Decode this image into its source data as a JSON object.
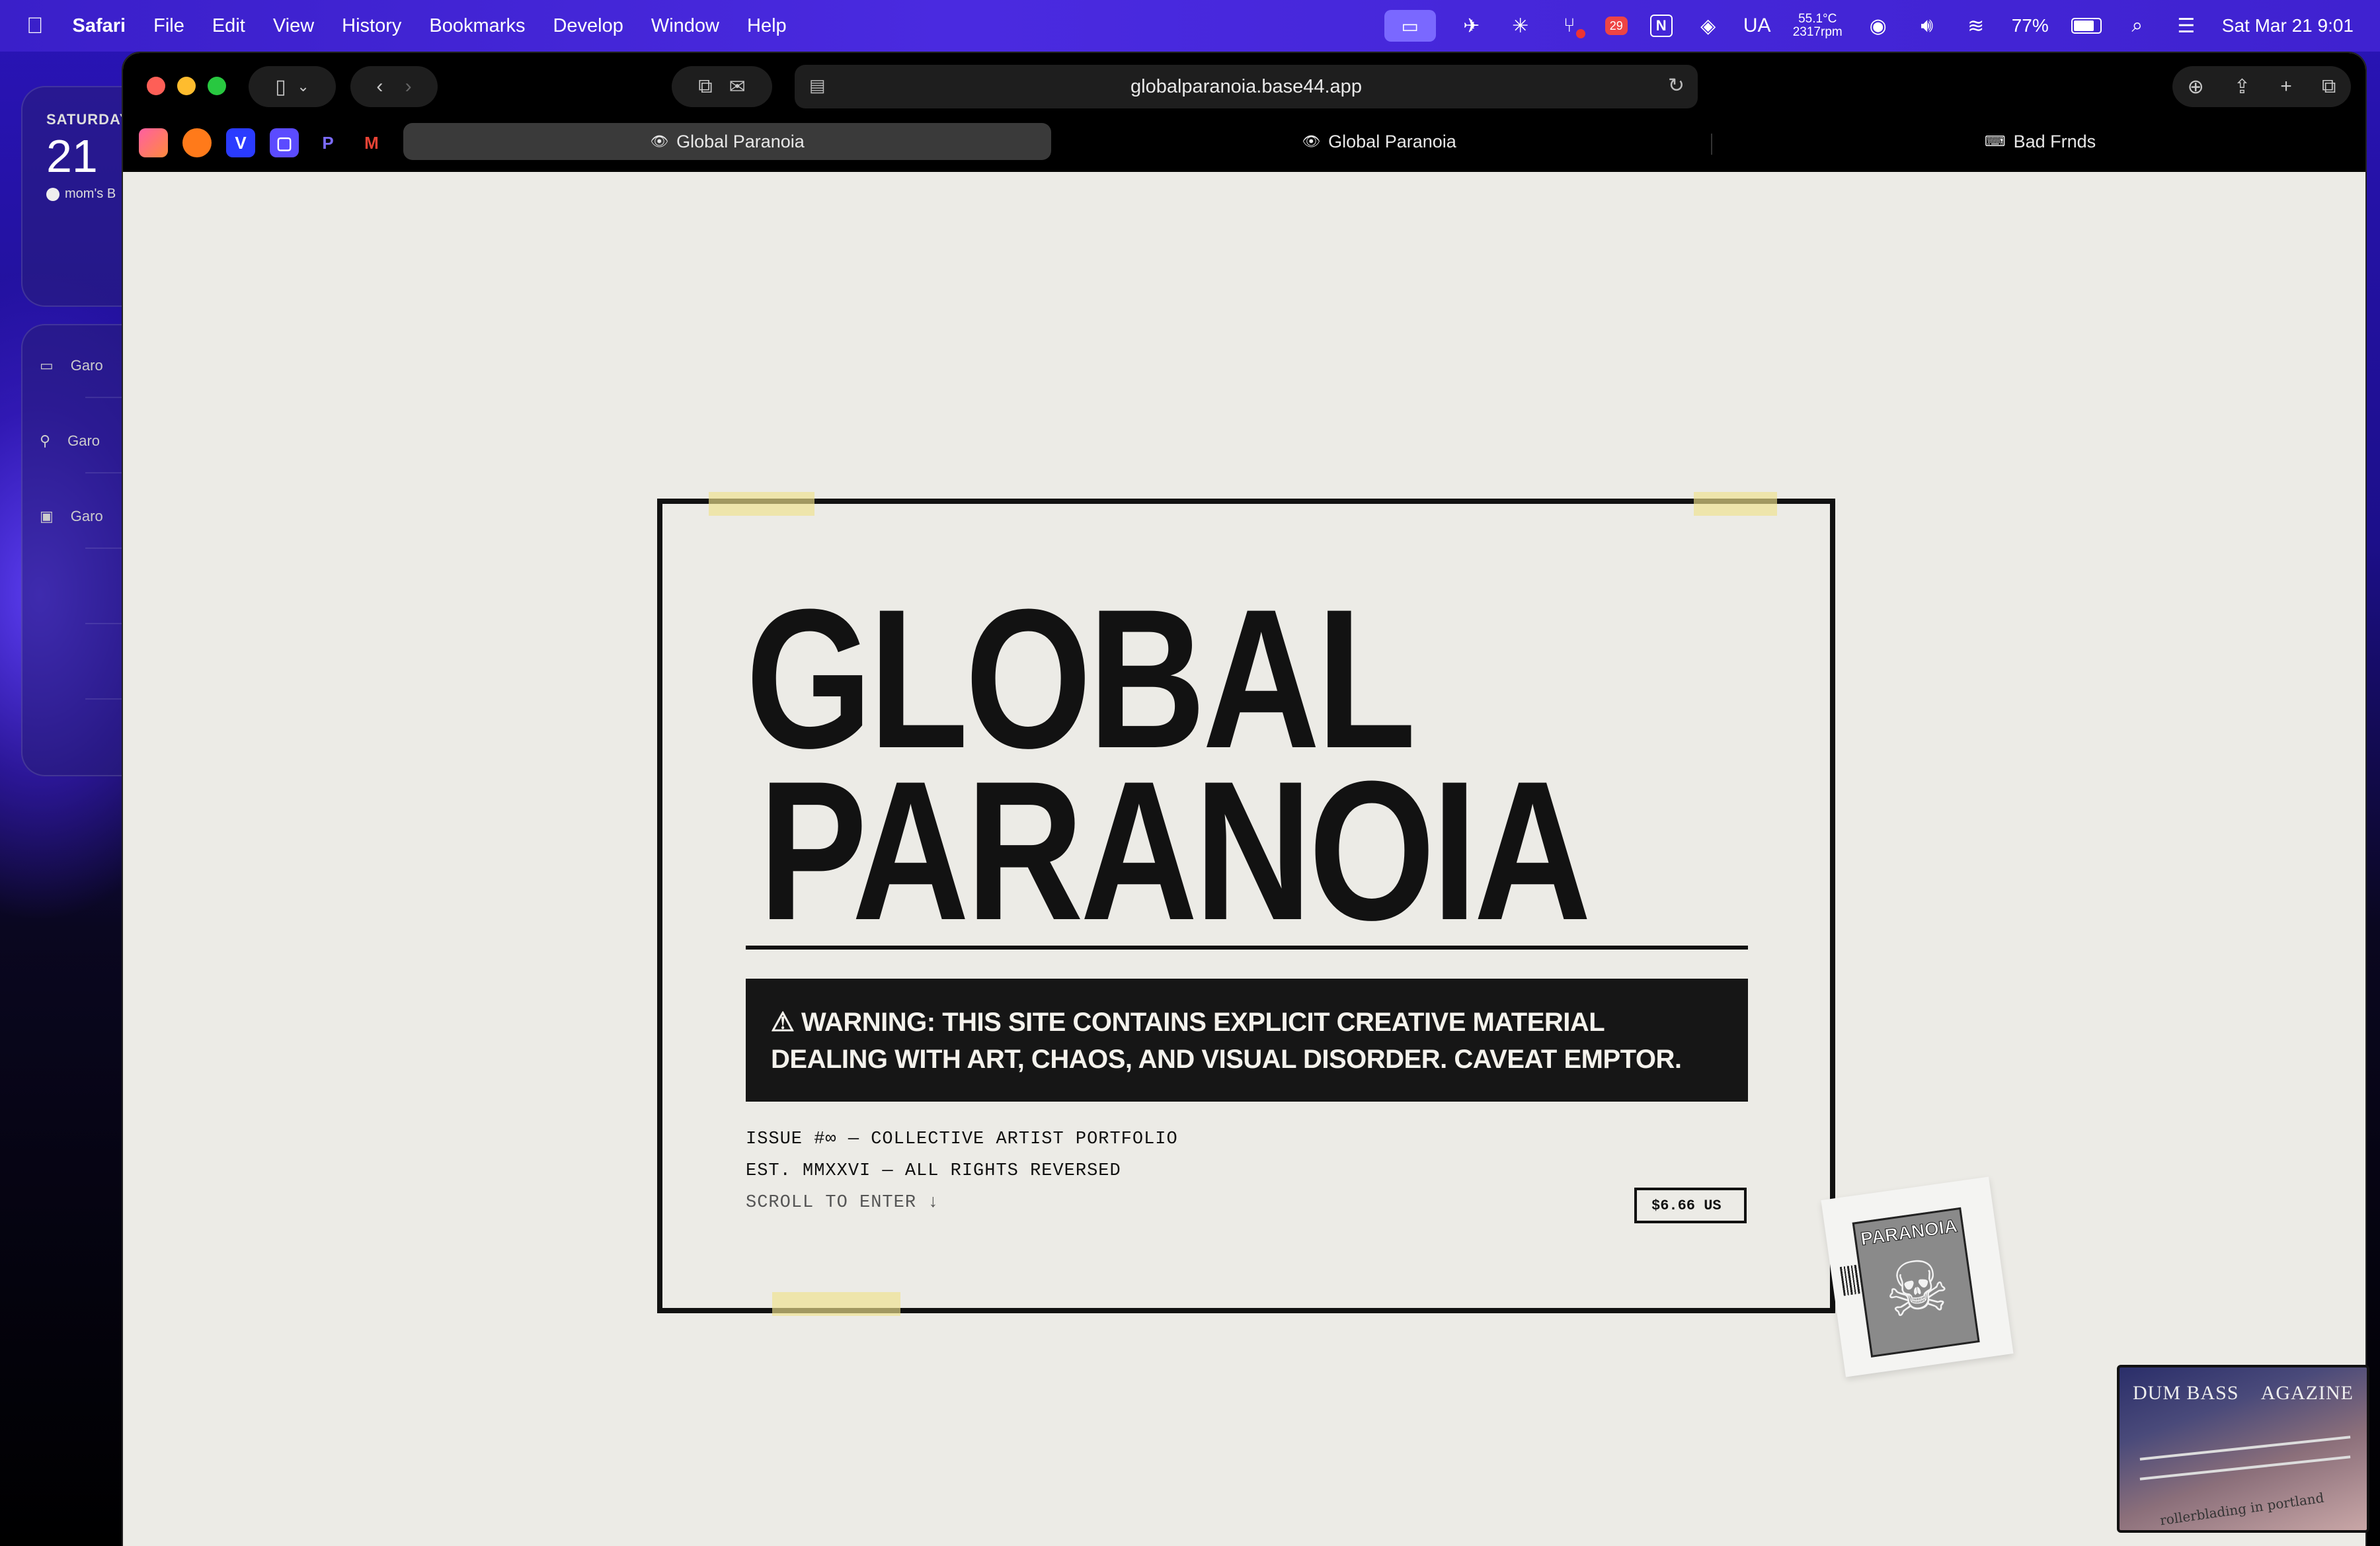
{
  "menubar": {
    "apple": "",
    "app": "Safari",
    "items": [
      "File",
      "Edit",
      "View",
      "History",
      "Bookmarks",
      "Develop",
      "Window",
      "Help"
    ],
    "badge_count": "29",
    "input_lang": "UA",
    "temp": "55.1°C",
    "rpm": "2317rpm",
    "battery": "77%",
    "datetime": "Sat Mar 21  9:01"
  },
  "widgets": {
    "calendar": {
      "weekday": "SATURDAY",
      "day": "21",
      "event": "mom's B"
    },
    "batteries": [
      "Garo",
      "Garo",
      "Garo"
    ]
  },
  "browser": {
    "url": "globalparanoia.base44.app",
    "tabs": [
      {
        "label": "Global Paranoia",
        "active": true
      },
      {
        "label": "Global Paranoia",
        "active": false
      },
      {
        "label": "Bad Frnds",
        "active": false
      }
    ],
    "favorites": [
      {
        "name": "app-1",
        "color": "#ff6b6b"
      },
      {
        "name": "app-2",
        "color": "#ff8a2a"
      },
      {
        "name": "app-3",
        "color": "#2a3bff",
        "glyph": "V"
      },
      {
        "name": "app-4",
        "color": "#5b4bff"
      },
      {
        "name": "app-5",
        "color": "#000000",
        "glyph": "P"
      },
      {
        "name": "gmail",
        "color": "#000000",
        "glyph": "M"
      }
    ]
  },
  "page": {
    "title_line1": "GLOBAL",
    "title_line2": "PARANOIA",
    "warning": "⚠ WARNING: THIS SITE CONTAINS EXPLICIT CREATIVE MATERIAL DEALING WITH ART, CHAOS, AND VISUAL DISORDER. CAVEAT EMPTOR.",
    "issue": "ISSUE #∞ — COLLECTIVE ARTIST PORTFOLIO",
    "established": "EST. MMXXVI — ALL RIGHTS REVERSED",
    "scroll": "SCROLL TO ENTER ↓",
    "price": "$6.66 US",
    "sticker_label": "PARANOIA"
  },
  "pip": {
    "title_left": "DUM BASS",
    "title_right": "AGAZINE",
    "caption": "rollerblading in portland"
  }
}
